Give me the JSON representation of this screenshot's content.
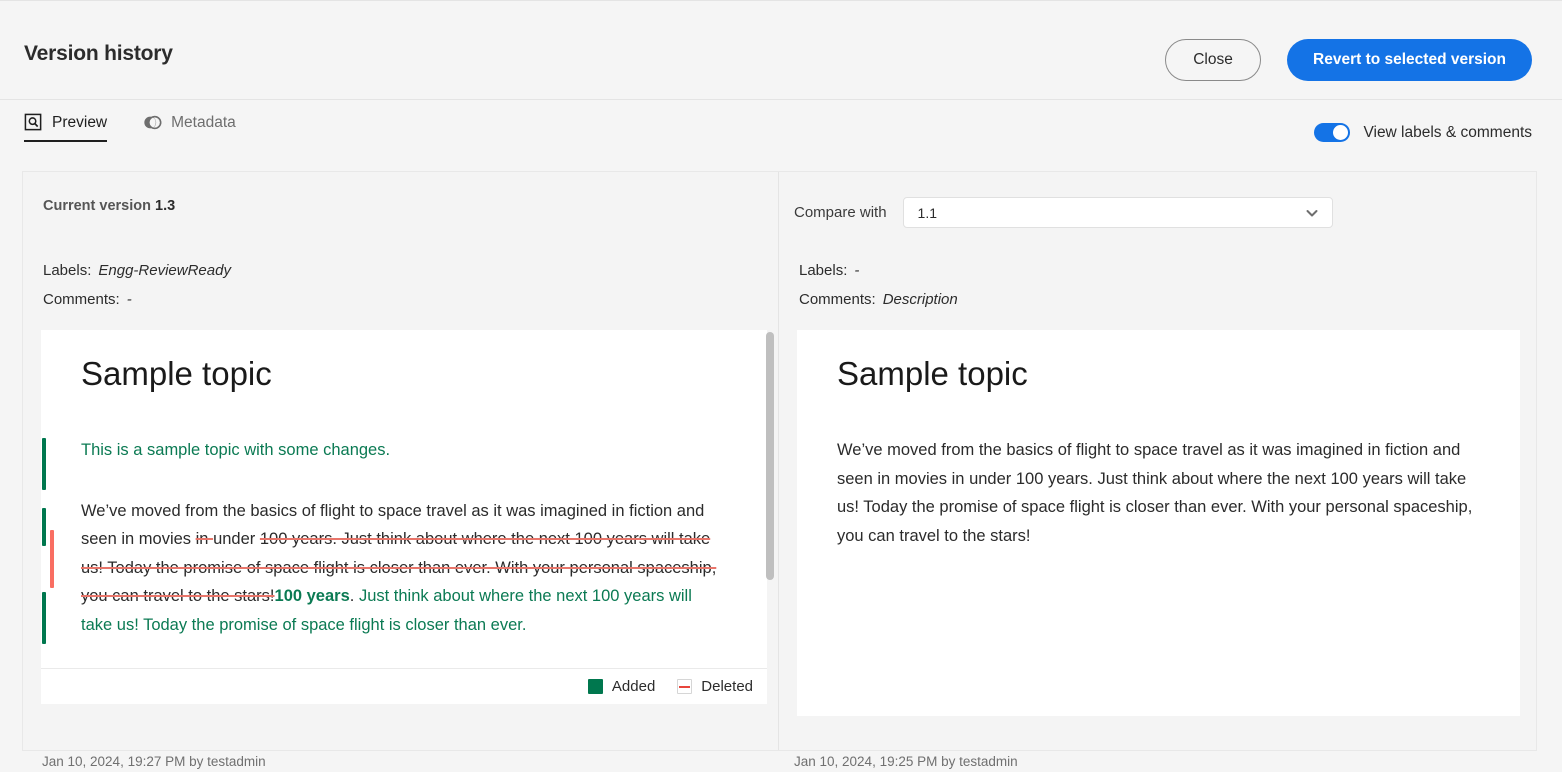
{
  "header": {
    "title": "Version history",
    "close_label": "Close",
    "revert_label": "Revert to selected version"
  },
  "tabs": [
    {
      "label": "Preview",
      "icon": "preview-magnifier-icon",
      "active": true
    },
    {
      "label": "Metadata",
      "icon": "metadata-venn-icon",
      "active": false
    }
  ],
  "toggle": {
    "label": "View labels & comments",
    "on": true,
    "accent": "#1473e6"
  },
  "left_panel": {
    "version_prefix": "Current version",
    "version_number": "1.3",
    "labels_key": "Labels:",
    "labels_value": "Engg-ReviewReady",
    "comments_key": "Comments:",
    "comments_value": "-",
    "doc_title": "Sample topic",
    "added_paragraph": "This is a sample topic with some changes.",
    "diff_runs": [
      {
        "type": "equal",
        "text": "We’ve moved from the basics of flight to space travel as it was imagined in fiction and seen in movies "
      },
      {
        "type": "deleted",
        "text": "in "
      },
      {
        "type": "equal",
        "text": "under "
      },
      {
        "type": "deleted",
        "text": "100 years. Just think about where the next 100 years will take us! Today the promise of space flight is closer than ever. With your personal spaceship, you can travel to the stars!"
      },
      {
        "type": "added_bold",
        "text": "100 years"
      },
      {
        "type": "equal",
        "text": "."
      },
      {
        "type": "added",
        "text": " Just think about where the next 100 years will take us! Today the promise of space flight is closer than ever."
      }
    ],
    "legend": [
      {
        "label": "Added",
        "swatch": "added",
        "color": "#00774e"
      },
      {
        "label": "Deleted",
        "swatch": "deleted",
        "color": "#e8453c"
      }
    ],
    "footer": "Jan 10, 2024, 19:27 PM by testadmin"
  },
  "right_panel": {
    "compare_label": "Compare with",
    "selected_version": "1.1",
    "labels_key": "Labels:",
    "labels_value": "-",
    "comments_key": "Comments:",
    "comments_value": "Description",
    "doc_title": "Sample topic",
    "body_paragraph": "We’ve moved from the basics of flight to space travel as it was imagined in fiction and seen in movies in under 100 years. Just think about where the next 100 years will take us! Today the promise of space flight is closer than ever. With your personal spaceship, you can travel to the stars!",
    "footer": "Jan 10, 2024, 19:25 PM by testadmin"
  }
}
